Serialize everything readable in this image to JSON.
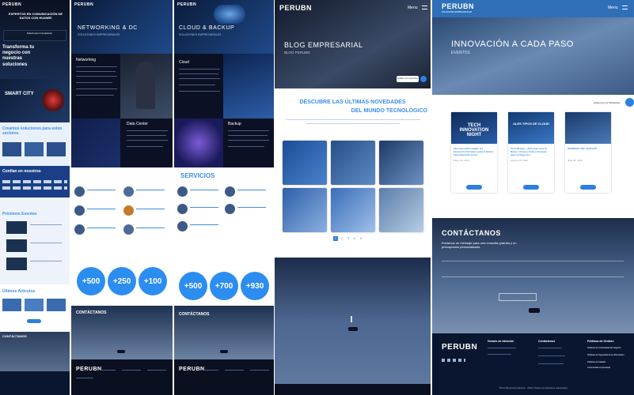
{
  "col1": {
    "logo": "PERUBN",
    "hero_title": "EXPERTOS EN COMUNICACIÓN DE DATOS CON HUAWEI",
    "hero_heading": "Transforma tu negocio con nuestras soluciones",
    "hero_card_title": "Soluciones innovadoras",
    "smart_city": "SMART CITY",
    "creamos": "Creamos soluciones para estos sectores",
    "confian": "Confían en nosotros",
    "proximos": "Próximos Eventos",
    "ultimos": "Últimos Artículos",
    "contactanos": "CONTÁCTANOS"
  },
  "col2": {
    "logo": "PERUBN",
    "hero_title": "NETWORKING & DC",
    "hero_sub": "SOLUCIONES EMPRESARIALES",
    "networking": "Networking",
    "datacenter": "Data Center",
    "contactanos": "CONTÁCTANOS",
    "stats": [
      "+500",
      "+250",
      "+100"
    ],
    "footer_logo": "PERUBN"
  },
  "col3": {
    "logo": "PERUBN",
    "hero_title": "CLOUD & BACKUP",
    "hero_sub": "SOLUCIONES EMPRESARIALES",
    "cloud": "Cloud",
    "backup": "Backup",
    "servicios": "SERVICIOS",
    "contactanos": "CONTÁCTANOS",
    "stats": [
      "+500",
      "+700",
      "+930"
    ],
    "footer_logo": "PERUBN"
  },
  "col4": {
    "logo": "PERUBN",
    "menu": "Menu",
    "blog_title": "BLOG EMPRESARIAL",
    "blog_sub": "BLOG PERUBN",
    "chat_label": "Habla con nosotros",
    "descubre_line1": "DESCUBRE LAS ÚLTIMAS NOVEDADES",
    "descubre_line2": "DEL MUNDO TECNOLÓGICO",
    "pages": [
      "1",
      "2",
      "3",
      "4",
      "5"
    ]
  },
  "col5": {
    "logo": "PERUBN",
    "logo_sub": "SOLUCIONES EMPRESARIALES",
    "menu": "Menu",
    "hero_title": "INNOVACIÓN A CADA PASO",
    "hero_sub": "EVENTOS",
    "whatsapp_label": "Hablemos por WhatsApp",
    "events": [
      {
        "banner": "TECH INNOVATION NIGHT",
        "title": "Tech Innovation Night: Un Encuentro Exclusivo para el Sector Agroindustrial en Ica",
        "date": "Mayo 30, 2024"
      },
      {
        "banner": "ALES TIPOS DE CLOUD",
        "title": "Tech Meetup: ¿Para qué sirve la Nube o Cloud y Cuál es la mejor para mi Negocio?",
        "date": "Agosto 29, 2023"
      },
      {
        "banner": "",
        "title": "WEBINAR LIFE / BACKUP",
        "date": "Julio 28, 2023"
      }
    ],
    "contactanos": "CONTÁCTANOS",
    "contact_text": "Envíenos un mensaje para una consulta gratuita y un presupuesto personalizado.",
    "footer_logo": "PERUBN",
    "footer_cols": [
      "Horario de Atención",
      "Contáctenos",
      "Políticas de Gestión"
    ],
    "policies": [
      "Políticas de Continuidad del Negocio",
      "Políticas de Seguridad de la Información",
      "Políticas de Calidad",
      "Comunicado empresarial"
    ],
    "copyright": "©Perú Business Network · 2024 | Todos los derechos reservados"
  },
  "colors": {
    "accent": "#2d7fe0",
    "navy": "#0b1a33",
    "heading_blue": "#3b8fe6"
  }
}
